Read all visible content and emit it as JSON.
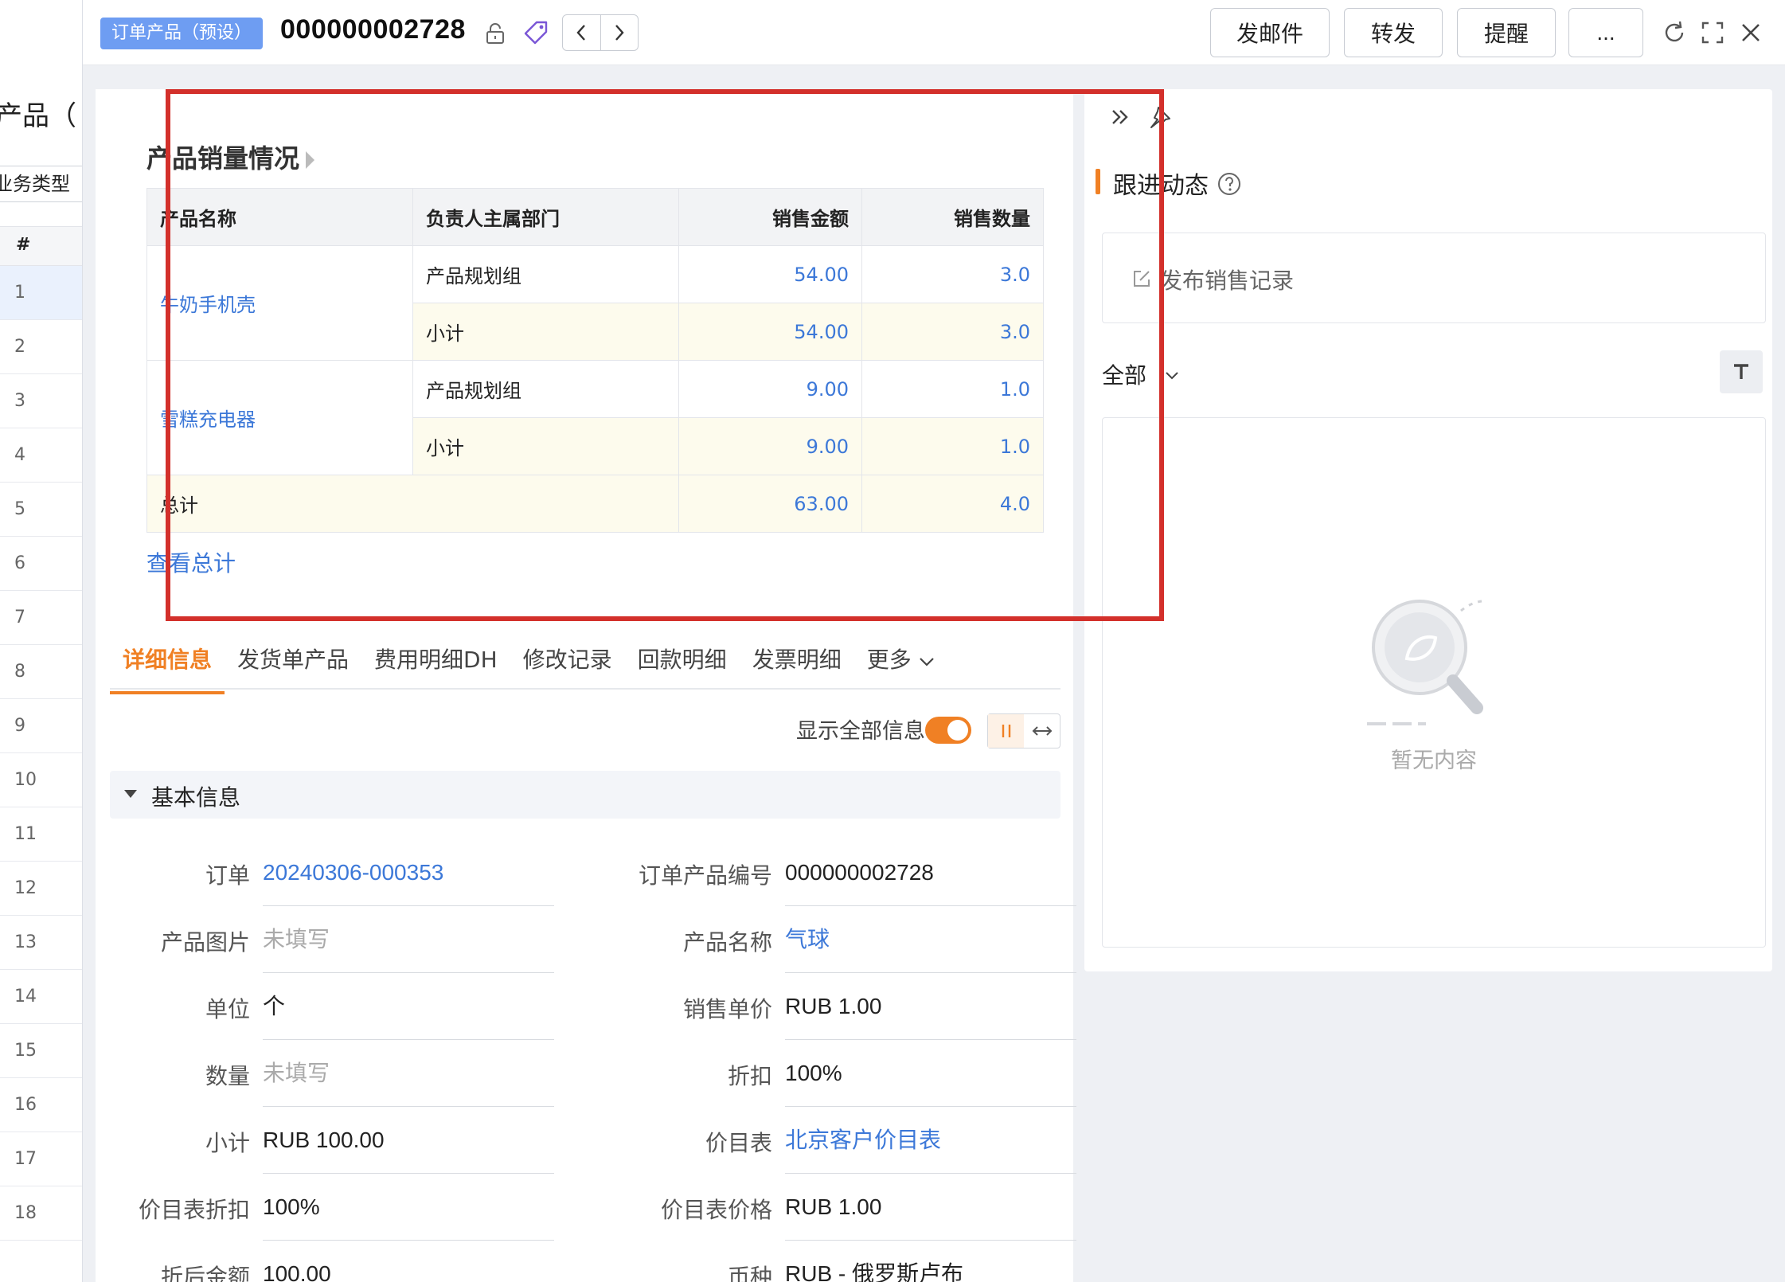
{
  "background_list": {
    "title": "产品（",
    "filter_label": "业务类型",
    "header_hash": "#",
    "row_numbers": [
      "1",
      "2",
      "3",
      "4",
      "5",
      "6",
      "7",
      "8",
      "9",
      "10",
      "11",
      "12",
      "13",
      "14",
      "15",
      "16",
      "17",
      "18"
    ]
  },
  "header": {
    "object_tag": "订单产品（预设）",
    "record_id": "000000002728",
    "buttons": [
      "发邮件",
      "转发",
      "提醒",
      "..."
    ]
  },
  "report": {
    "title": "产品销量情况",
    "columns": [
      "产品名称",
      "负责人主属部门",
      "销售金额",
      "销售数量"
    ],
    "groups": [
      {
        "product": "牛奶手机壳",
        "rows": [
          {
            "dept": "产品规划组",
            "amount": "54.00",
            "qty": "3.0"
          },
          {
            "dept": "小计",
            "amount": "54.00",
            "qty": "3.0"
          }
        ]
      },
      {
        "product": "雪糕充电器",
        "rows": [
          {
            "dept": "产品规划组",
            "amount": "9.00",
            "qty": "1.0"
          },
          {
            "dept": "小计",
            "amount": "9.00",
            "qty": "1.0"
          }
        ]
      }
    ],
    "total": {
      "label": "总计",
      "amount": "63.00",
      "qty": "4.0"
    },
    "view_total_link": "查看总计"
  },
  "tabs": [
    "详细信息",
    "发货单产品",
    "费用明细DH",
    "修改记录",
    "回款明细",
    "发票明细",
    "更多"
  ],
  "active_tab": 0,
  "show_all_label": "显示全部信息",
  "show_all_on": true,
  "section": {
    "title": "基本信息"
  },
  "fields": {
    "left": [
      {
        "label": "订单",
        "value": "20240306-000353",
        "style": "link"
      },
      {
        "label": "产品图片",
        "value": "未填写",
        "style": "empty"
      },
      {
        "label": "单位",
        "value": "个",
        "style": ""
      },
      {
        "label": "数量",
        "value": "未填写",
        "style": "empty"
      },
      {
        "label": "小计",
        "value": "RUB 100.00",
        "style": ""
      },
      {
        "label": "价目表折扣",
        "value": "100%",
        "style": ""
      },
      {
        "label": "折后金额",
        "value": "100.00",
        "style": ""
      }
    ],
    "right": [
      {
        "label": "订单产品编号",
        "value": "000000002728",
        "style": ""
      },
      {
        "label": "产品名称",
        "value": "气球",
        "style": "link"
      },
      {
        "label": "销售单价",
        "value": "RUB 1.00",
        "style": ""
      },
      {
        "label": "折扣",
        "value": "100%",
        "style": ""
      },
      {
        "label": "价目表",
        "value": "北京客户价目表",
        "style": "link"
      },
      {
        "label": "价目表价格",
        "value": "RUB 1.00",
        "style": ""
      },
      {
        "label": "币种",
        "value": "RUB - 俄罗斯卢布",
        "style": ""
      }
    ]
  },
  "side": {
    "title": "跟进动态",
    "post_placeholder": "发布销售记录",
    "filter": "全部",
    "empty_text": "暂无内容"
  },
  "colors": {
    "accent": "#f08024",
    "link": "#3c78d8",
    "highlight_frame": "#d3302b",
    "tag_bg": "#6e9df2"
  }
}
